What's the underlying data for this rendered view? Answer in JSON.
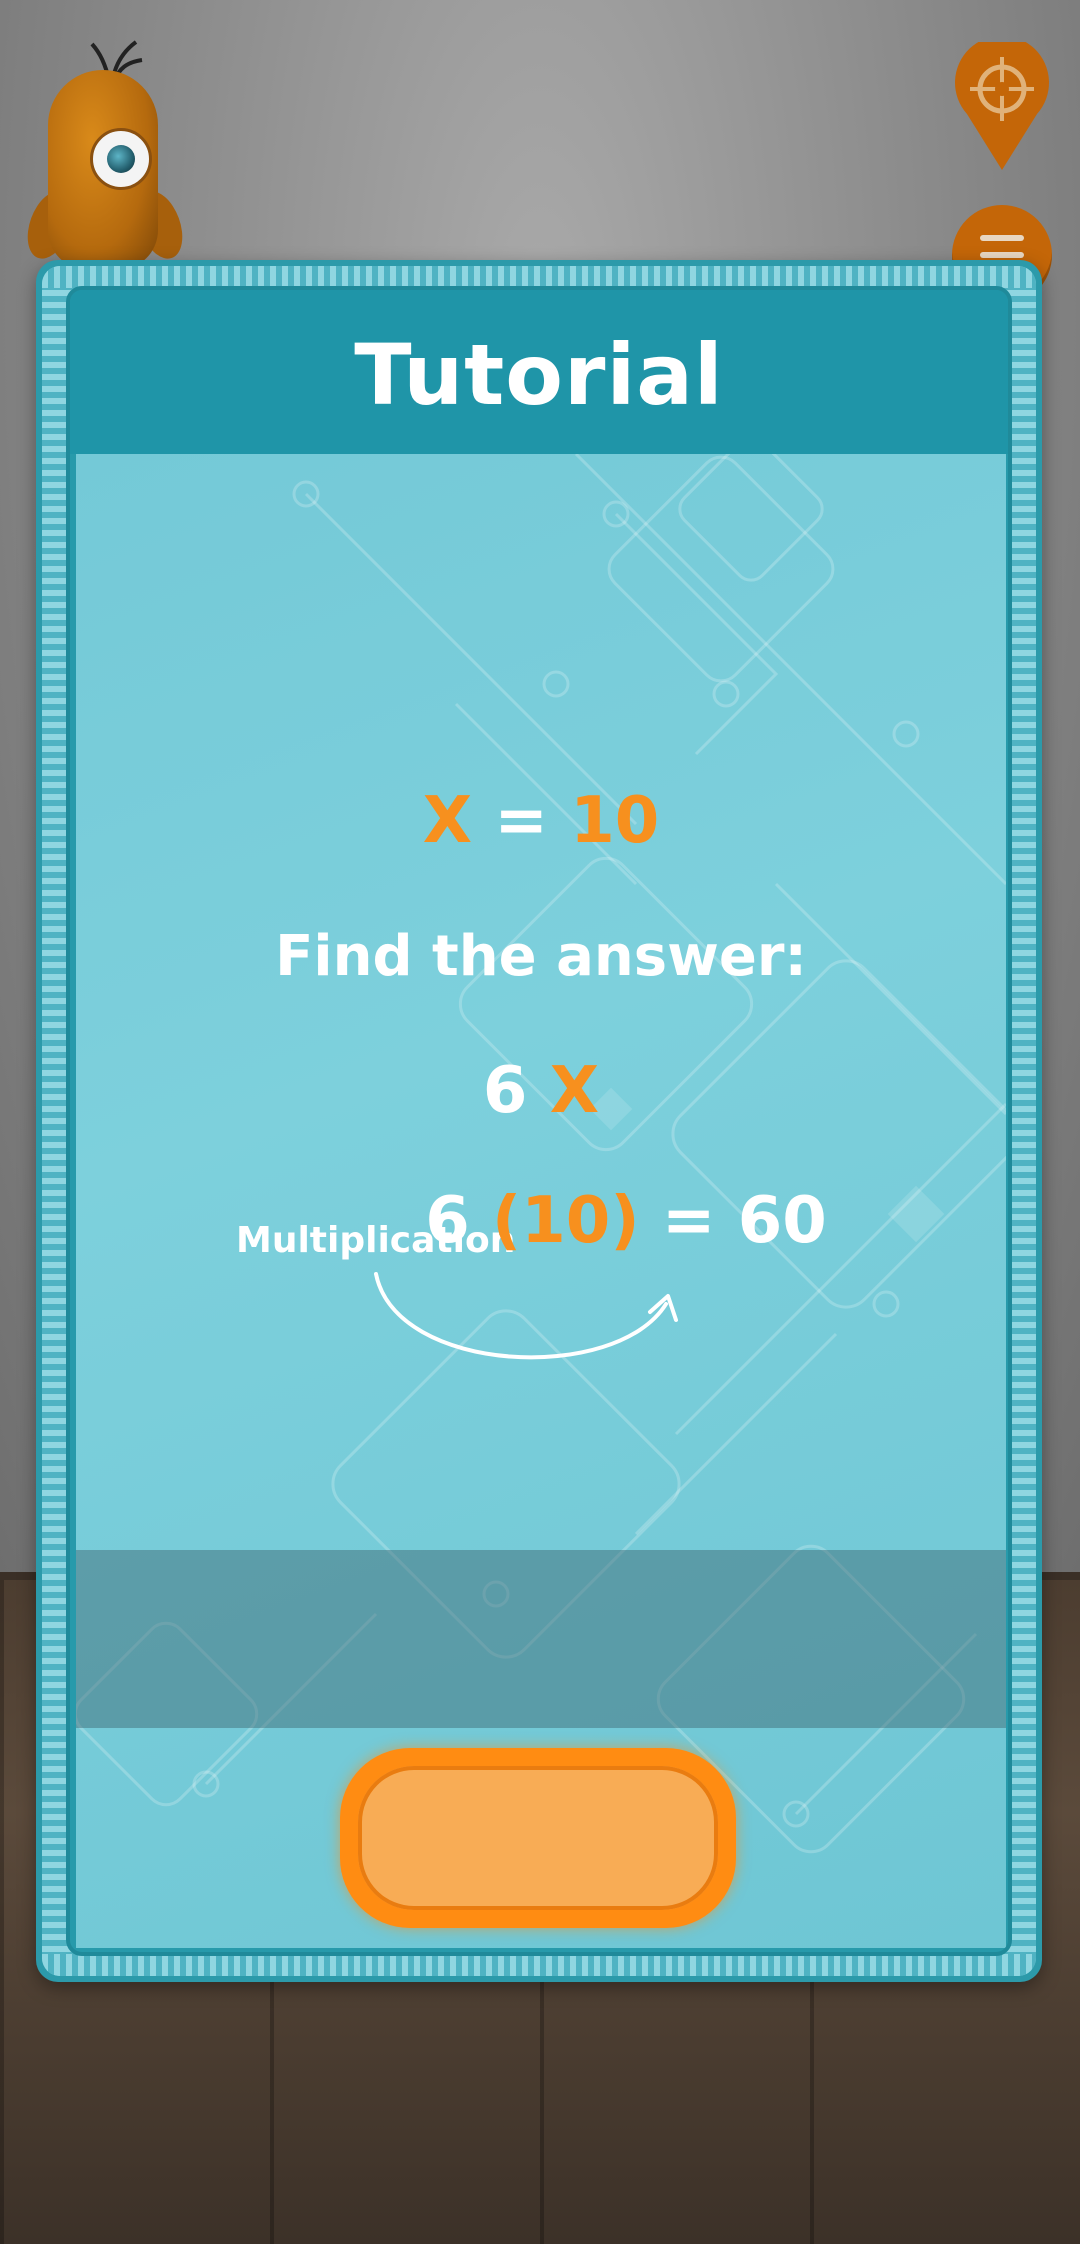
{
  "dialog": {
    "title": "Tutorial",
    "variable_name": "X",
    "variable_equals": " = ",
    "variable_value": "10",
    "prompt": "Find the answer:",
    "expression_coefficient": "6 ",
    "expression_variable": "X",
    "solution_coefficient": "6 ",
    "solution_substitution": "(10)",
    "solution_result": " = 60",
    "operation_label": "Multiplication",
    "action_button_label": ""
  },
  "colors": {
    "accent_orange": "#f7901e",
    "dialog_teal": "#1f95a8",
    "content_bg": "#7dd0dc",
    "button_orange": "#ff8c12"
  },
  "icons": {
    "top_right_1": "location-target-icon",
    "top_right_2": "menu-icon",
    "mascot": "one-eyed-orange-mascot"
  }
}
